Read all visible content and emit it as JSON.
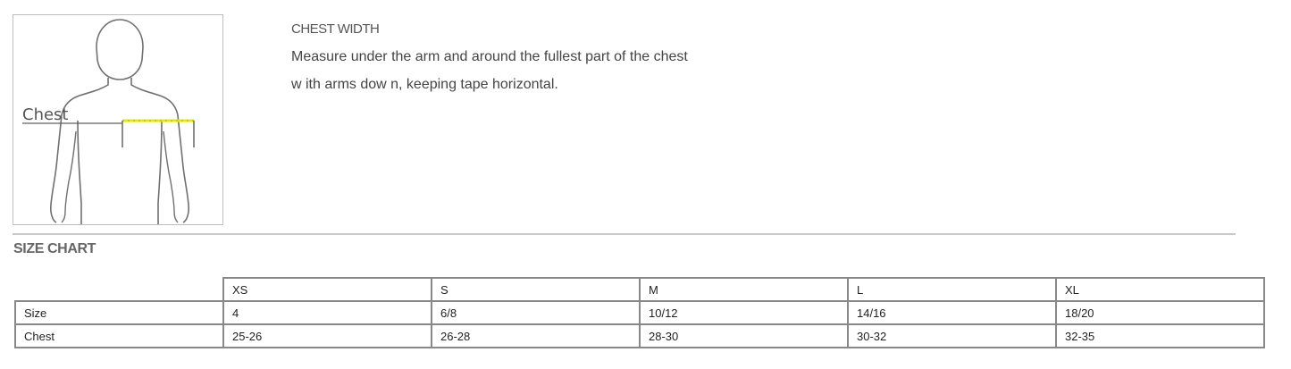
{
  "figure": {
    "chest_label": "Chest",
    "colors": {
      "outline": "#707070",
      "tape": "#e8e800"
    }
  },
  "measurement": {
    "title": "CHEST WIDTH",
    "line1": "Measure under the arm and around the fullest part of the chest",
    "line2": "w ith arms dow n, keeping tape horizontal."
  },
  "size_chart": {
    "title": "SIZE CHART",
    "columns": [
      "XS",
      "S",
      "M",
      "L",
      "XL"
    ],
    "rows": [
      {
        "label": "Size",
        "values": [
          "4",
          "6/8",
          "10/12",
          "14/16",
          "18/20"
        ]
      },
      {
        "label": "Chest",
        "values": [
          "25-26",
          "26-28",
          "28-30",
          "30-32",
          "32-35"
        ]
      }
    ]
  }
}
